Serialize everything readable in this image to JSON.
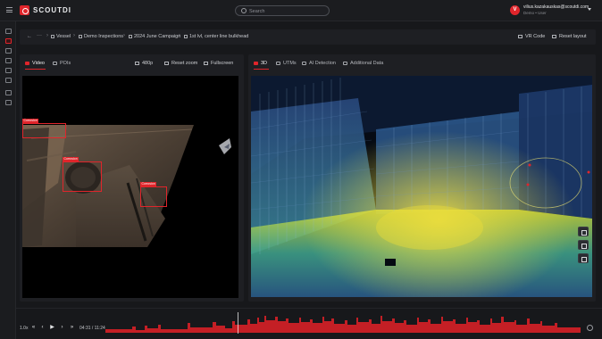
{
  "app": {
    "brand": "SCOUTDI"
  },
  "search": {
    "placeholder": "Search"
  },
  "user": {
    "initial": "V",
    "email": "vilius.kazakauskas@scoutdi.com",
    "role": "Demo • User"
  },
  "breadcrumb": {
    "items": [
      {
        "label": "Vessel",
        "icon": "ship-icon"
      },
      {
        "label": "Demo Inspections",
        "icon": "folder-icon"
      },
      {
        "label": "2024 June Campaign",
        "icon": "calendar-icon"
      },
      {
        "label": "1st lvl, center line bulkhead",
        "icon": "video-icon"
      }
    ],
    "actions": {
      "vr_code": "VR Code",
      "reset_layout": "Reset layout"
    }
  },
  "left_panel": {
    "tabs": [
      {
        "label": "Video",
        "active": true
      },
      {
        "label": "POIs",
        "active": false
      }
    ],
    "controls": {
      "resolution": "480p",
      "reset_zoom": "Reset zoom",
      "fullscreen": "Fullscreen"
    },
    "detections": [
      {
        "label": "Corrosion"
      },
      {
        "label": "Corrosion"
      },
      {
        "label": "Corrosion"
      }
    ]
  },
  "right_panel": {
    "tabs": [
      {
        "label": "3D",
        "active": true
      },
      {
        "label": "UTMs",
        "active": false
      },
      {
        "label": "AI Detection",
        "active": false
      },
      {
        "label": "Additional Data",
        "active": false
      }
    ],
    "tools": [
      "info-icon",
      "map-icon",
      "layers-icon"
    ]
  },
  "timeline": {
    "speed": "1.0x",
    "time": "04:31 / 11:24",
    "progress": 0.28
  },
  "colors": {
    "accent": "#e0252b",
    "background": "#17181b",
    "panel": "#1e1f23"
  }
}
